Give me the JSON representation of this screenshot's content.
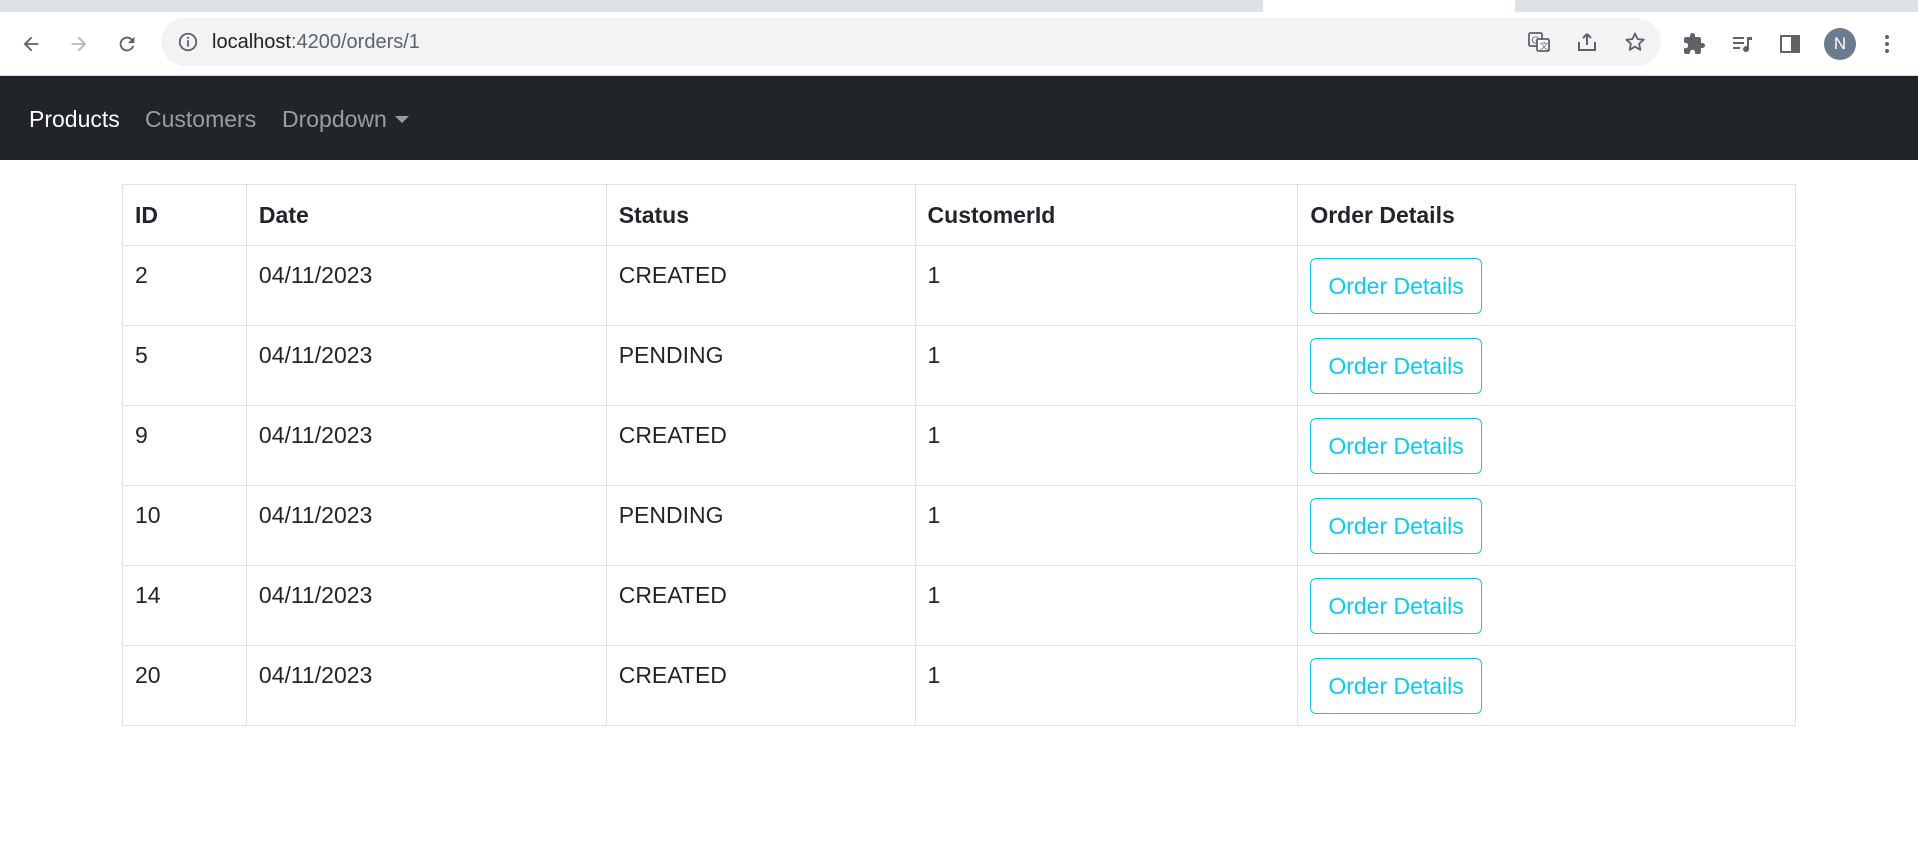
{
  "browser": {
    "url_host": "localhost",
    "url_path": ":4200/orders/1",
    "profile_initial": "N"
  },
  "navbar": {
    "items": [
      {
        "label": "Products",
        "active": true
      },
      {
        "label": "Customers",
        "active": false
      },
      {
        "label": "Dropdown",
        "active": false
      }
    ]
  },
  "table": {
    "headers": [
      "ID",
      "Date",
      "Status",
      "CustomerId",
      "Order Details"
    ],
    "rows": [
      {
        "id": "2",
        "date": "04/11/2023",
        "status": "CREATED",
        "customer_id": "1",
        "action": "Order Details"
      },
      {
        "id": "5",
        "date": "04/11/2023",
        "status": "PENDING",
        "customer_id": "1",
        "action": "Order Details"
      },
      {
        "id": "9",
        "date": "04/11/2023",
        "status": "CREATED",
        "customer_id": "1",
        "action": "Order Details"
      },
      {
        "id": "10",
        "date": "04/11/2023",
        "status": "PENDING",
        "customer_id": "1",
        "action": "Order Details"
      },
      {
        "id": "14",
        "date": "04/11/2023",
        "status": "CREATED",
        "customer_id": "1",
        "action": "Order Details"
      },
      {
        "id": "20",
        "date": "04/11/2023",
        "status": "CREATED",
        "customer_id": "1",
        "action": "Order Details"
      }
    ]
  },
  "colors": {
    "navbar_bg": "#212529",
    "button_info": "#0dcaf0"
  },
  "icons": [
    "back-arrow-icon",
    "forward-arrow-icon",
    "reload-icon",
    "info-icon",
    "translate-icon",
    "share-icon",
    "star-icon",
    "extensions-icon",
    "media-queue-icon",
    "side-panel-icon",
    "kebab-menu-icon"
  ]
}
